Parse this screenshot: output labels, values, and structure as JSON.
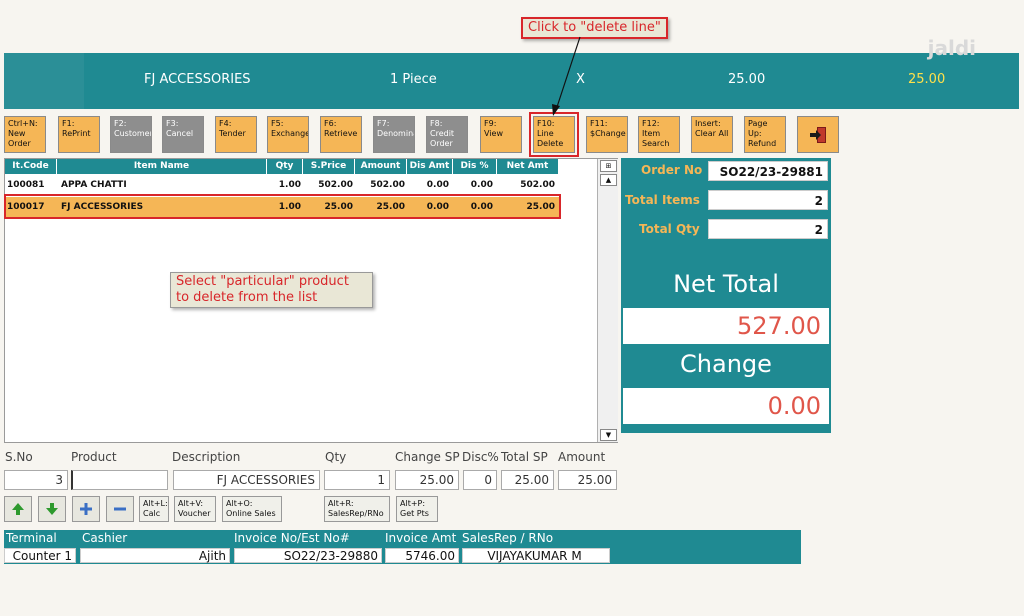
{
  "header": {
    "product": "FJ ACCESSORIES",
    "qty": "1 Piece",
    "x": "X",
    "price": "25.00",
    "total": "25.00",
    "watermark": "jaldi"
  },
  "fkeys": [
    {
      "l1": "Ctrl+N:",
      "l2": "New",
      "l3": "Order"
    },
    {
      "l1": "F1:",
      "l2": "RePrint",
      "l3": ""
    },
    {
      "l1": "F2:",
      "l2": "Customer",
      "l3": ""
    },
    {
      "l1": "F3:",
      "l2": "Cancel",
      "l3": ""
    },
    {
      "l1": "F4:",
      "l2": "Tender",
      "l3": ""
    },
    {
      "l1": "F5:",
      "l2": "Exchange",
      "l3": ""
    },
    {
      "l1": "F6:",
      "l2": "Retrieve",
      "l3": ""
    },
    {
      "l1": "F7:",
      "l2": "Denomina",
      "l3": ""
    },
    {
      "l1": "F8:",
      "l2": "Credit",
      "l3": "Order"
    },
    {
      "l1": "F9:",
      "l2": "View",
      "l3": ""
    },
    {
      "l1": "F10:",
      "l2": "Line",
      "l3": "Delete"
    },
    {
      "l1": "F11:",
      "l2": "$Change",
      "l3": ""
    },
    {
      "l1": "F12:",
      "l2": "Item",
      "l3": "Search"
    },
    {
      "l1": "Insert:",
      "l2": "Clear All",
      "l3": ""
    },
    {
      "l1": "Page Up:",
      "l2": "Refund",
      "l3": ""
    }
  ],
  "grid": {
    "headers": [
      "It.Code",
      "Item Name",
      "Qty",
      "S.Price",
      "Amount",
      "Dis Amt",
      "Dis %",
      "Net Amt"
    ],
    "rows": [
      {
        "code": "100081",
        "name": "APPA CHATTI",
        "qty": "1.00",
        "price": "502.00",
        "amount": "502.00",
        "disamt": "0.00",
        "dispct": "0.00",
        "net": "502.00"
      },
      {
        "code": "100017",
        "name": "FJ ACCESSORIES",
        "qty": "1.00",
        "price": "25.00",
        "amount": "25.00",
        "disamt": "0.00",
        "dispct": "0.00",
        "net": "25.00"
      }
    ]
  },
  "summary": {
    "order_label": "Order No",
    "order_no": "SO22/23-29881",
    "items_label": "Total Items",
    "items": "2",
    "qty_label": "Total Qty",
    "qty": "2",
    "net_label": "Net Total",
    "net": "527.00",
    "change_label": "Change",
    "change": "0.00"
  },
  "callouts": {
    "delete_line": "Click to \"delete line\"",
    "select_1": "Select \"particular\" product",
    "select_2": "to delete from the list"
  },
  "entry": {
    "labels": {
      "sno": "S.No",
      "product": "Product",
      "desc": "Description",
      "qty": "Qty",
      "changesp": "Change SP",
      "disc": "Disc%",
      "totalsp": "Total SP",
      "amount": "Amount"
    },
    "values": {
      "sno": "3",
      "product": "",
      "desc": "FJ ACCESSORIES",
      "qty": "1",
      "changesp": "25.00",
      "disc": "0",
      "totalsp": "25.00",
      "amount": "25.00"
    }
  },
  "shortcuts": [
    {
      "l1": "Alt+L:",
      "l2": "Calc"
    },
    {
      "l1": "Alt+V:",
      "l2": "Voucher"
    },
    {
      "l1": "Alt+O:",
      "l2": "Online Sales"
    },
    {
      "l1": "Alt+R:",
      "l2": "SalesRep/RNo"
    },
    {
      "l1": "Alt+P:",
      "l2": "Get Pts"
    }
  ],
  "footer": {
    "labels": {
      "terminal": "Terminal",
      "cashier": "Cashier",
      "invoice": "Invoice No/Est No#",
      "amt": "Invoice Amt",
      "rep": "SalesRep / RNo"
    },
    "values": {
      "terminal": "Counter 1",
      "cashier": "Ajith",
      "invoice": "SO22/23-29880",
      "amt": "5746.00",
      "rep": "VIJAYAKUMAR M"
    }
  },
  "colors": {
    "teal": "#1f8a92",
    "orange": "#f5b656",
    "red": "#d8262a",
    "net": "#e0564a"
  }
}
